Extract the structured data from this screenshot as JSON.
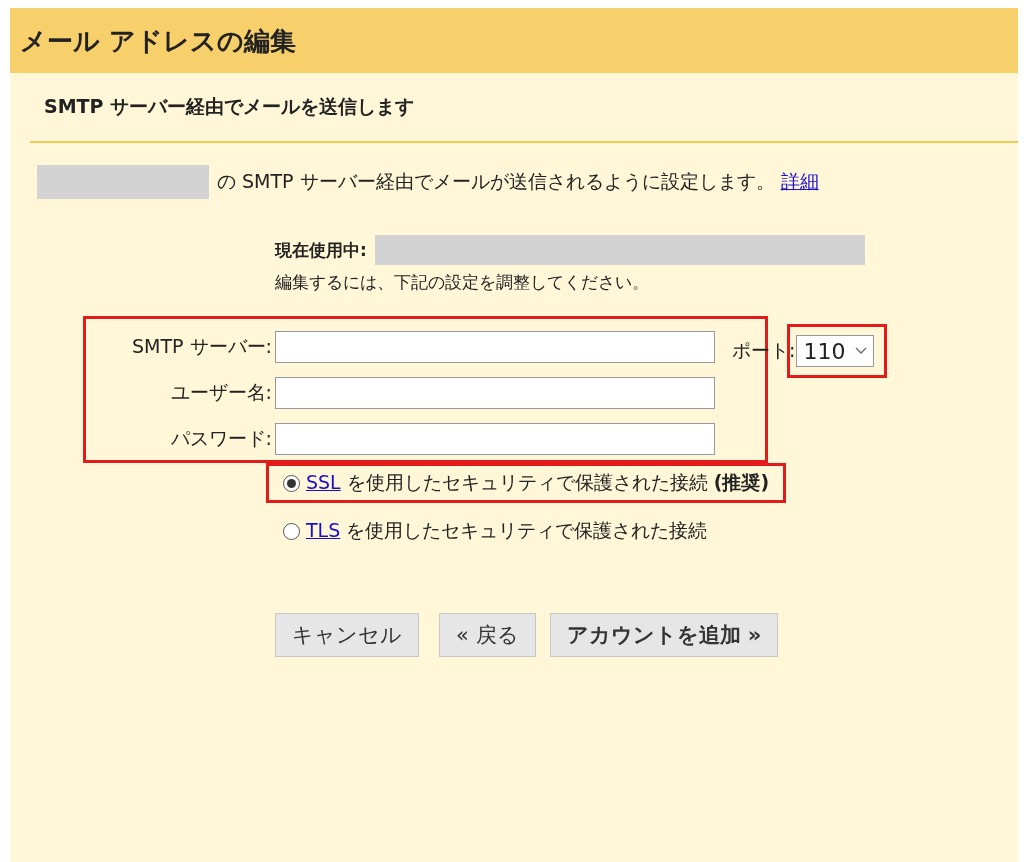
{
  "window": {
    "title": "メール アドレスの編集"
  },
  "section_title": "SMTP サーバー経由でメールを送信します",
  "intro": {
    "text": "の SMTP サーバー経由でメールが送信されるように設定します。",
    "link": "詳細"
  },
  "current": {
    "label": "現在使用中:",
    "note": "編集するには、下記の設定を調整してください。"
  },
  "fields": [
    {
      "label": "SMTP サーバー:"
    },
    {
      "label": "ユーザー名:"
    },
    {
      "label": "パスワード:"
    }
  ],
  "port": {
    "label": "ポート:",
    "value": "110"
  },
  "security": [
    {
      "link": "SSL",
      "text": "を使用したセキュリティで保護された接続 **(推奨)**",
      "selected": true
    },
    {
      "link": "TLS",
      "text": "を使用したセキュリティで保護された接続",
      "selected": false
    }
  ],
  "buttons": [
    {
      "label": "キャンセル",
      "primary": false
    },
    {
      "label": "« 戻る",
      "primary": false
    },
    {
      "label": "アカウントを追加 »",
      "primary": true
    }
  ]
}
